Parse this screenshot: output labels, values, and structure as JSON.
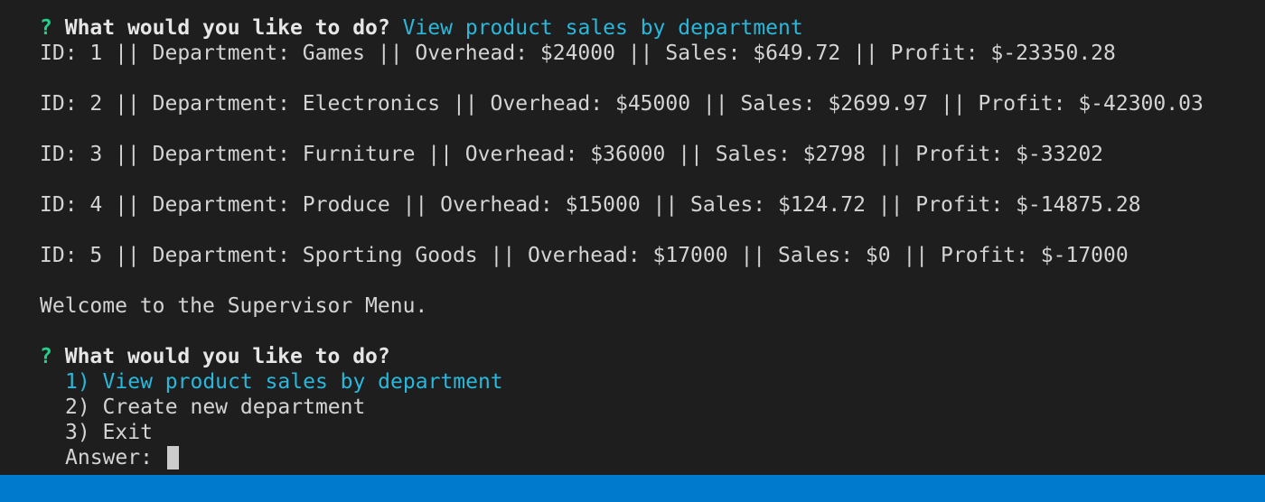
{
  "prompt1": {
    "qmark": "?",
    "question": "What would you like to do?",
    "answer": "View product sales by department"
  },
  "rows": [
    "ID: 1 || Department: Games || Overhead: $24000 || Sales: $649.72 || Profit: $-23350.28",
    "ID: 2 || Department: Electronics || Overhead: $45000 || Sales: $2699.97 || Profit: $-42300.03",
    "ID: 3 || Department: Furniture || Overhead: $36000 || Sales: $2798 || Profit: $-33202",
    "ID: 4 || Department: Produce || Overhead: $15000 || Sales: $124.72 || Profit: $-14875.28",
    "ID: 5 || Department: Sporting Goods || Overhead: $17000 || Sales: $0 || Profit: $-17000"
  ],
  "welcome": "Welcome to the Supervisor Menu.",
  "prompt2": {
    "qmark": "?",
    "question": "What would you like to do?",
    "options": [
      "1) View product sales by department",
      "2) Create new department",
      "3) Exit"
    ],
    "answer_label": "Answer: "
  },
  "colors": {
    "background": "#1e1e1e",
    "prompt_mark": "#23d18b",
    "highlight": "#29b8db",
    "statusbar": "#007acc"
  }
}
